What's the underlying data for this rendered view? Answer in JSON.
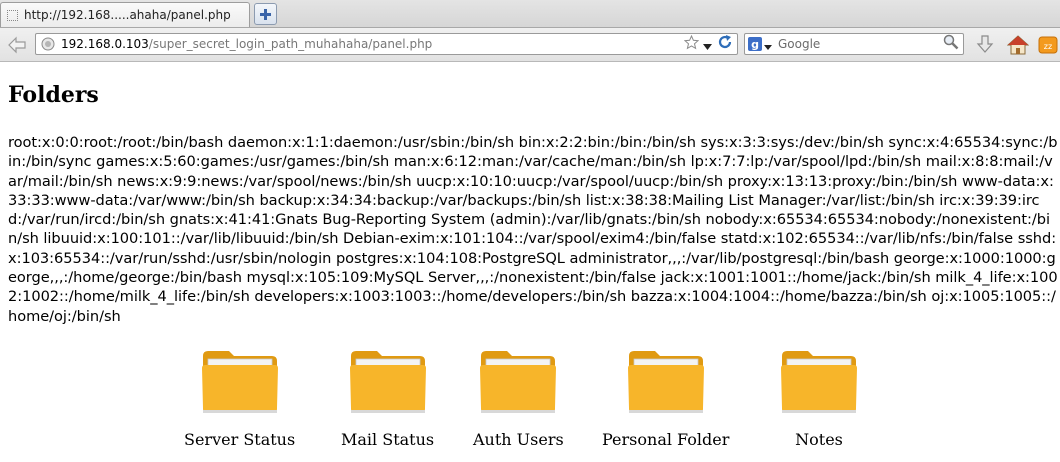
{
  "browser": {
    "tab_title": "http://192.168.....ahaha/panel.php",
    "url_host": "192.168.0.103",
    "url_path": "/super_secret_login_path_muhahaha/panel.php",
    "search_placeholder": "Google",
    "search_engine": "g",
    "icons": [
      "back-icon",
      "site-identity-icon",
      "bookmark-star-icon",
      "url-dropdown-icon",
      "reload-icon",
      "search-engine-icon",
      "magnifier-icon",
      "download-icon",
      "home-icon",
      "addon-icon",
      "new-tab-icon"
    ]
  },
  "page": {
    "title": "Folders",
    "passwd_text": "root:x:0:0:root:/root:/bin/bash daemon:x:1:1:daemon:/usr/sbin:/bin/sh bin:x:2:2:bin:/bin:/bin/sh sys:x:3:3:sys:/dev:/bin/sh sync:x:4:65534:sync:/bin:/bin/sync games:x:5:60:games:/usr/games:/bin/sh man:x:6:12:man:/var/cache/man:/bin/sh lp:x:7:7:lp:/var/spool/lpd:/bin/sh mail:x:8:8:mail:/var/mail:/bin/sh news:x:9:9:news:/var/spool/news:/bin/sh uucp:x:10:10:uucp:/var/spool/uucp:/bin/sh proxy:x:13:13:proxy:/bin:/bin/sh www-data:x:33:33:www-data:/var/www:/bin/sh backup:x:34:34:backup:/var/backups:/bin/sh list:x:38:38:Mailing List Manager:/var/list:/bin/sh irc:x:39:39:ircd:/var/run/ircd:/bin/sh gnats:x:41:41:Gnats Bug-Reporting System (admin):/var/lib/gnats:/bin/sh nobody:x:65534:65534:nobody:/nonexistent:/bin/sh libuuid:x:100:101::/var/lib/libuuid:/bin/sh Debian-exim:x:101:104::/var/spool/exim4:/bin/false statd:x:102:65534::/var/lib/nfs:/bin/false sshd:x:103:65534::/var/run/sshd:/usr/sbin/nologin postgres:x:104:108:PostgreSQL administrator,,,:/var/lib/postgresql:/bin/bash george:x:1000:1000:george,,,:/home/george:/bin/bash mysql:x:105:109:MySQL Server,,,:/nonexistent:/bin/false jack:x:1001:1001::/home/jack:/bin/sh milk_4_life:x:1002:1002::/home/milk_4_life:/bin/sh developers:x:1003:1003::/home/developers:/bin/sh bazza:x:1004:1004::/home/bazza:/bin/sh oj:x:1005:1005::/home/oj:/bin/sh",
    "folders": [
      {
        "label": "Server Status",
        "icon": "folder-icon"
      },
      {
        "label": "Mail Status",
        "icon": "folder-icon"
      },
      {
        "label": "Auth Users",
        "icon": "folder-icon"
      },
      {
        "label": "Personal Folder",
        "icon": "folder-icon"
      },
      {
        "label": "Notes",
        "icon": "folder-icon"
      }
    ]
  },
  "colors": {
    "folder_front": "#f7b52a",
    "folder_back": "#e09a12",
    "folder_paper": "#f3f3f3"
  }
}
